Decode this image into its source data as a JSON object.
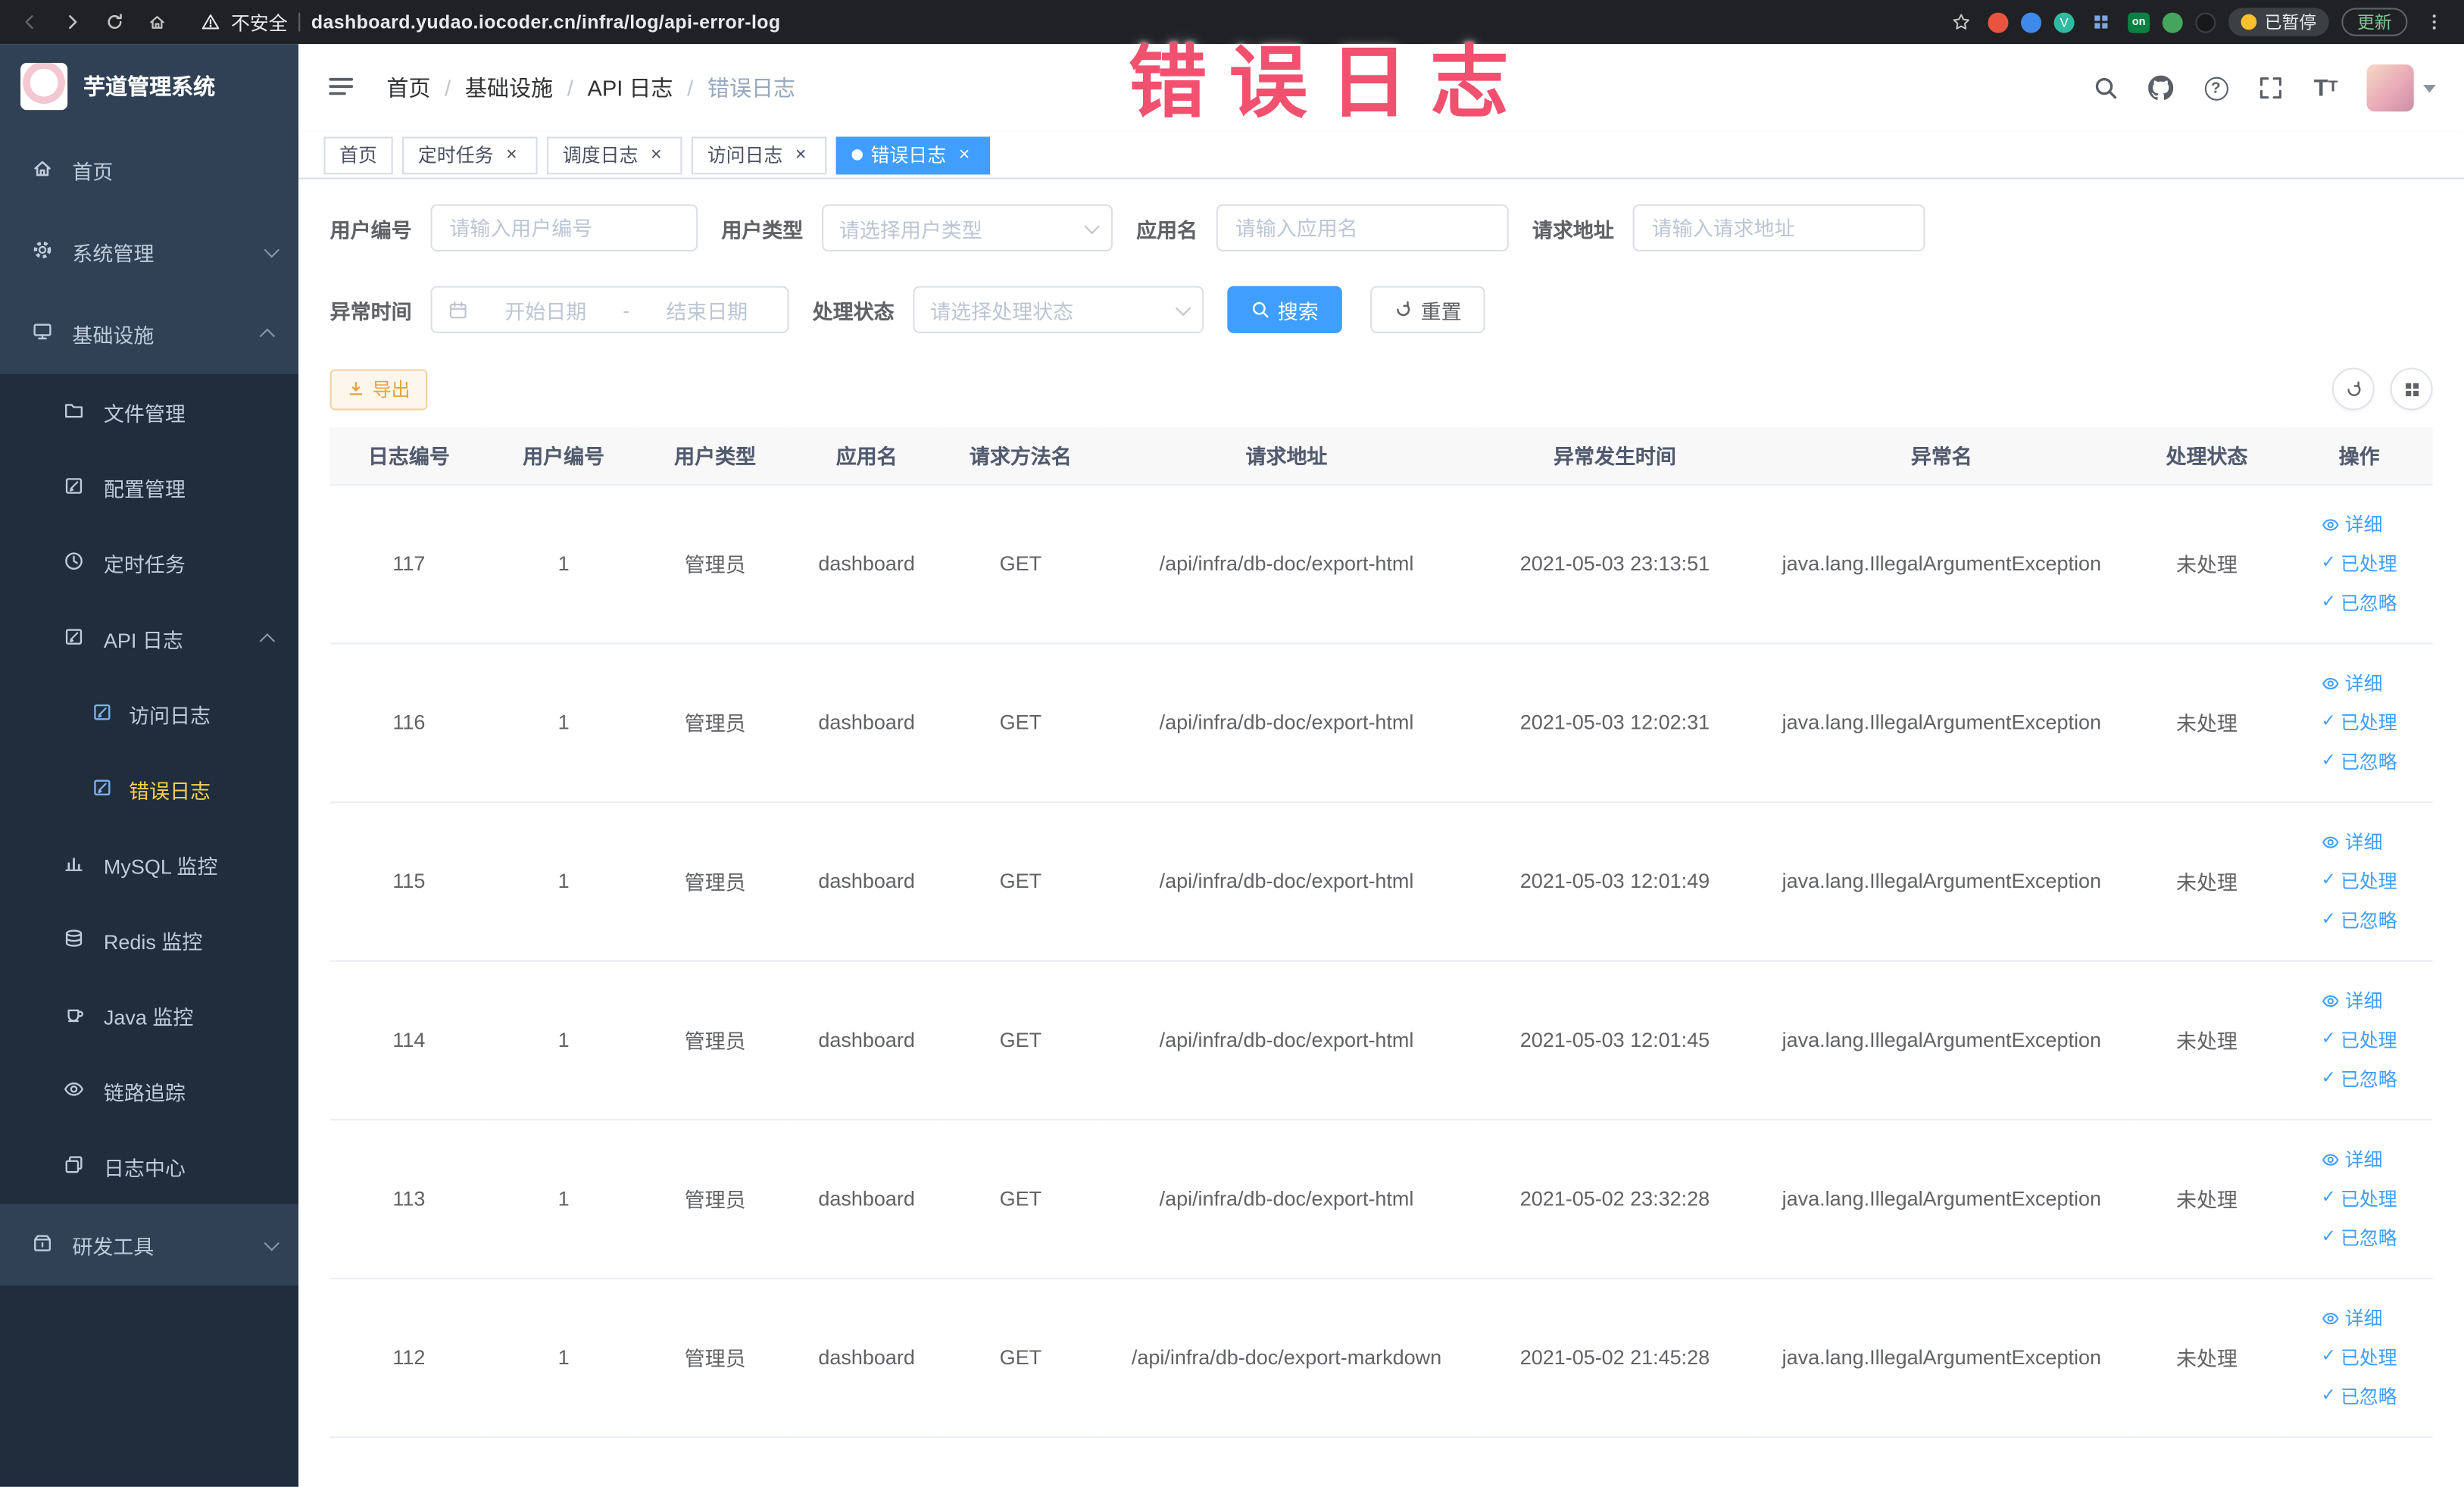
{
  "browser": {
    "security_label": "不安全",
    "url": "dashboard.yudao.iocoder.cn/infra/log/api-error-log",
    "on_badge": "on",
    "paused_badge": "已暂停",
    "update_label": "更新"
  },
  "annotation": {
    "text": "错误日志"
  },
  "sidebar": {
    "app_title": "芋道管理系统",
    "items": [
      {
        "label": "首页"
      },
      {
        "label": "系统管理"
      },
      {
        "label": "基础设施"
      },
      {
        "label": "文件管理"
      },
      {
        "label": "配置管理"
      },
      {
        "label": "定时任务"
      },
      {
        "label": "API 日志"
      },
      {
        "label": "访问日志"
      },
      {
        "label": "错误日志"
      },
      {
        "label": "MySQL 监控"
      },
      {
        "label": "Redis 监控"
      },
      {
        "label": "Java 监控"
      },
      {
        "label": "链路追踪"
      },
      {
        "label": "日志中心"
      },
      {
        "label": "研发工具"
      }
    ]
  },
  "navbar": {
    "breadcrumb": [
      {
        "label": "首页"
      },
      {
        "label": "基础设施"
      },
      {
        "label": "API 日志"
      },
      {
        "label": "错误日志"
      }
    ]
  },
  "tabs": [
    {
      "label": "首页"
    },
    {
      "label": "定时任务"
    },
    {
      "label": "调度日志"
    },
    {
      "label": "访问日志"
    },
    {
      "label": "错误日志"
    }
  ],
  "filters": {
    "user_id": {
      "label": "用户编号",
      "placeholder": "请输入用户编号",
      "value": ""
    },
    "user_type": {
      "label": "用户类型",
      "placeholder": "请选择用户类型"
    },
    "app_name": {
      "label": "应用名",
      "placeholder": "请输入应用名",
      "value": ""
    },
    "request_url": {
      "label": "请求地址",
      "placeholder": "请输入请求地址",
      "value": ""
    },
    "exception_time": {
      "label": "异常时间",
      "start_placeholder": "开始日期",
      "separator": "-",
      "end_placeholder": "结束日期"
    },
    "process_status": {
      "label": "处理状态",
      "placeholder": "请选择处理状态"
    },
    "search_label": "搜索",
    "reset_label": "重置"
  },
  "toolbar": {
    "export_label": "导出"
  },
  "table": {
    "columns": [
      "日志编号",
      "用户编号",
      "用户类型",
      "应用名",
      "请求方法名",
      "请求地址",
      "异常发生时间",
      "异常名",
      "处理状态",
      "操作"
    ],
    "actions": [
      "详细",
      "已处理",
      "已忽略"
    ],
    "rows": [
      {
        "id": "117",
        "user_id": "1",
        "user_type": "管理员",
        "app": "dashboard",
        "method": "GET",
        "url": "/api/infra/db-doc/export-html",
        "time": "2021-05-03 23:13:51",
        "exception": "java.lang.IllegalArgumentException",
        "status": "未处理"
      },
      {
        "id": "116",
        "user_id": "1",
        "user_type": "管理员",
        "app": "dashboard",
        "method": "GET",
        "url": "/api/infra/db-doc/export-html",
        "time": "2021-05-03 12:02:31",
        "exception": "java.lang.IllegalArgumentException",
        "status": "未处理"
      },
      {
        "id": "115",
        "user_id": "1",
        "user_type": "管理员",
        "app": "dashboard",
        "method": "GET",
        "url": "/api/infra/db-doc/export-html",
        "time": "2021-05-03 12:01:49",
        "exception": "java.lang.IllegalArgumentException",
        "status": "未处理"
      },
      {
        "id": "114",
        "user_id": "1",
        "user_type": "管理员",
        "app": "dashboard",
        "method": "GET",
        "url": "/api/infra/db-doc/export-html",
        "time": "2021-05-03 12:01:45",
        "exception": "java.lang.IllegalArgumentException",
        "status": "未处理"
      },
      {
        "id": "113",
        "user_id": "1",
        "user_type": "管理员",
        "app": "dashboard",
        "method": "GET",
        "url": "/api/infra/db-doc/export-html",
        "time": "2021-05-02 23:32:28",
        "exception": "java.lang.IllegalArgumentException",
        "status": "未处理"
      },
      {
        "id": "112",
        "user_id": "1",
        "user_type": "管理员",
        "app": "dashboard",
        "method": "GET",
        "url": "/api/infra/db-doc/export-markdown",
        "time": "2021-05-02 21:45:28",
        "exception": "java.lang.IllegalArgumentException",
        "status": "未处理"
      }
    ]
  }
}
